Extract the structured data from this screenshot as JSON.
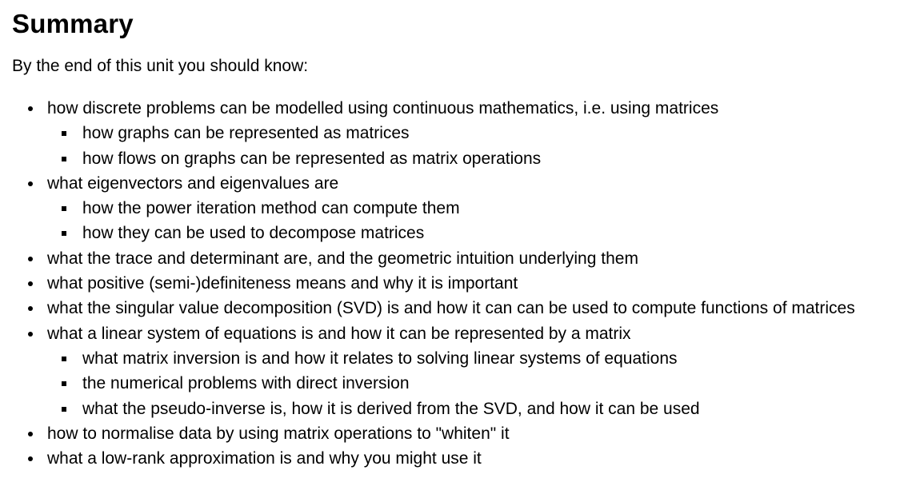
{
  "title": "Summary",
  "intro": "By the end of this unit you should know:",
  "items": [
    {
      "text": "how discrete problems can be modelled using continuous mathematics, i.e. using matrices",
      "sub": [
        "how graphs can be represented as matrices",
        "how flows on graphs can be represented as matrix operations"
      ]
    },
    {
      "text": "what eigenvectors and eigenvalues are",
      "sub": [
        "how the power iteration method can compute them",
        "how they can be used to decompose matrices"
      ]
    },
    {
      "text": "what the trace and determinant are, and the geometric intuition underlying them",
      "sub": []
    },
    {
      "text": "what positive (semi-)definiteness means and why it is important",
      "sub": []
    },
    {
      "text": "what the singular value decomposition (SVD) is and how it can can be used to compute functions of matrices",
      "sub": []
    },
    {
      "text": "what a linear system of equations is and how it can be represented by a matrix",
      "sub": [
        "what matrix inversion is and how it relates to solving linear systems of equations",
        "the numerical problems with direct inversion",
        "what the pseudo-inverse is, how it is derived from the SVD, and how it can be used"
      ]
    },
    {
      "text": "how to normalise data by using matrix operations to \"whiten\" it",
      "sub": []
    },
    {
      "text": "what a low-rank approximation is and why you might use it",
      "sub": []
    }
  ]
}
